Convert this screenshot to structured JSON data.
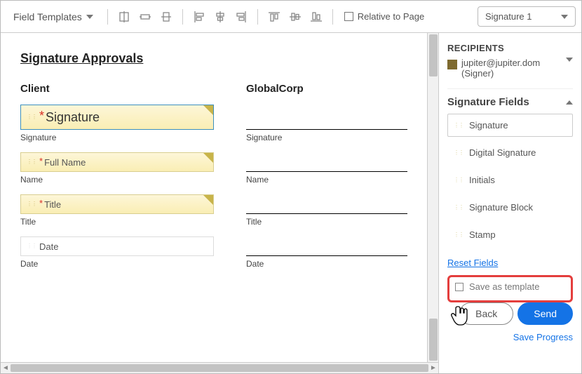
{
  "toolbar": {
    "fieldTemplatesLabel": "Field Templates",
    "relativeLabel": "Relative to Page",
    "signatureSelect": "Signature 1"
  },
  "document": {
    "title": "Signature Approvals",
    "clientHead": "Client",
    "corpHead": "GlobalCorp",
    "fields": {
      "signature": "Signature",
      "fullName": "Full Name",
      "title": "Title",
      "date": "Date"
    },
    "labels": {
      "signature": "Signature",
      "name": "Name",
      "title": "Title",
      "date": "Date"
    }
  },
  "side": {
    "recipientsHead": "RECIPIENTS",
    "recipientEmail": "jupiter@jupiter.dom",
    "recipientRole": "(Signer)",
    "panelHead": "Signature Fields",
    "items": {
      "signature": "Signature",
      "digital": "Digital Signature",
      "initials": "Initials",
      "block": "Signature Block",
      "stamp": "Stamp"
    },
    "resetLabel": "Reset Fields",
    "saveTemplateLabel": "Save as template",
    "backLabel": "Back",
    "sendLabel": "Send",
    "saveProgressLabel": "Save Progress"
  }
}
